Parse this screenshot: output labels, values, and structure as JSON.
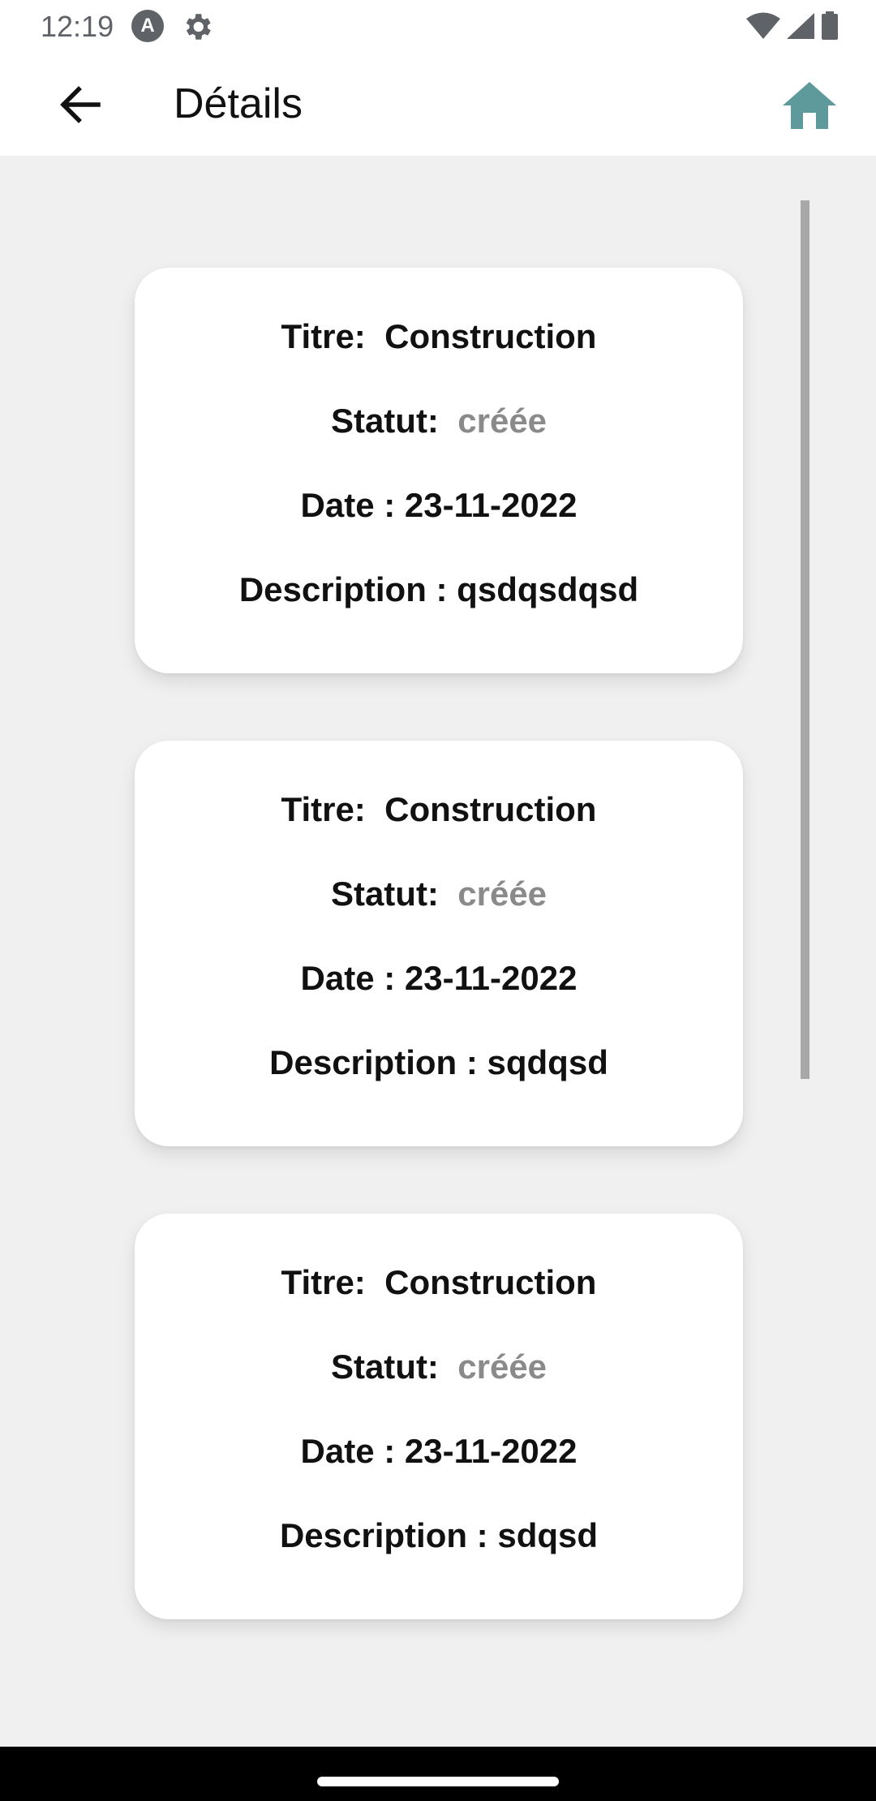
{
  "status_bar": {
    "time": "12:19",
    "a_icon": "A"
  },
  "app_bar": {
    "title": "Détails",
    "back_icon": "arrow-left-icon",
    "home_icon": "home-icon",
    "home_color": "#5e999c"
  },
  "cards": [
    {
      "title_label": "Titre:",
      "title_value": "Construction",
      "status_label": "Statut:",
      "status_value": "créée",
      "date_text": "Date : 23-11-2022",
      "description_text": "Description : qsdqsdqsd"
    },
    {
      "title_label": "Titre:",
      "title_value": "Construction",
      "status_label": "Statut:",
      "status_value": "créée",
      "date_text": "Date : 23-11-2022",
      "description_text": "Description : sqdqsd"
    },
    {
      "title_label": "Titre:",
      "title_value": "Construction",
      "status_label": "Statut:",
      "status_value": "créée",
      "date_text": "Date : 23-11-2022",
      "description_text": "Description : sdqsd"
    }
  ]
}
